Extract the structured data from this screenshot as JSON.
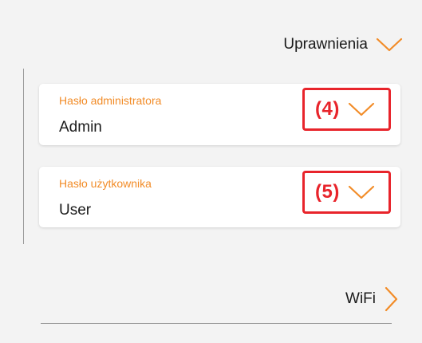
{
  "sections": {
    "permissions": {
      "title": "Uprawnienia",
      "icon": "chevron-down-icon",
      "expanded": true
    },
    "wifi": {
      "title": "WiFi",
      "icon": "chevron-right-icon",
      "expanded": false
    }
  },
  "fields": [
    {
      "label": "Hasło administratora",
      "value": "Admin",
      "marker": "(4)",
      "icon": "chevron-down-icon"
    },
    {
      "label": "Hasło użytkownika",
      "value": "User",
      "marker": "(5)",
      "icon": "chevron-down-icon"
    }
  ],
  "colors": {
    "accent": "#f28c28",
    "marker": "#e8242b",
    "background": "#f3f3f3",
    "card": "#ffffff",
    "text": "#1a1a1a"
  }
}
